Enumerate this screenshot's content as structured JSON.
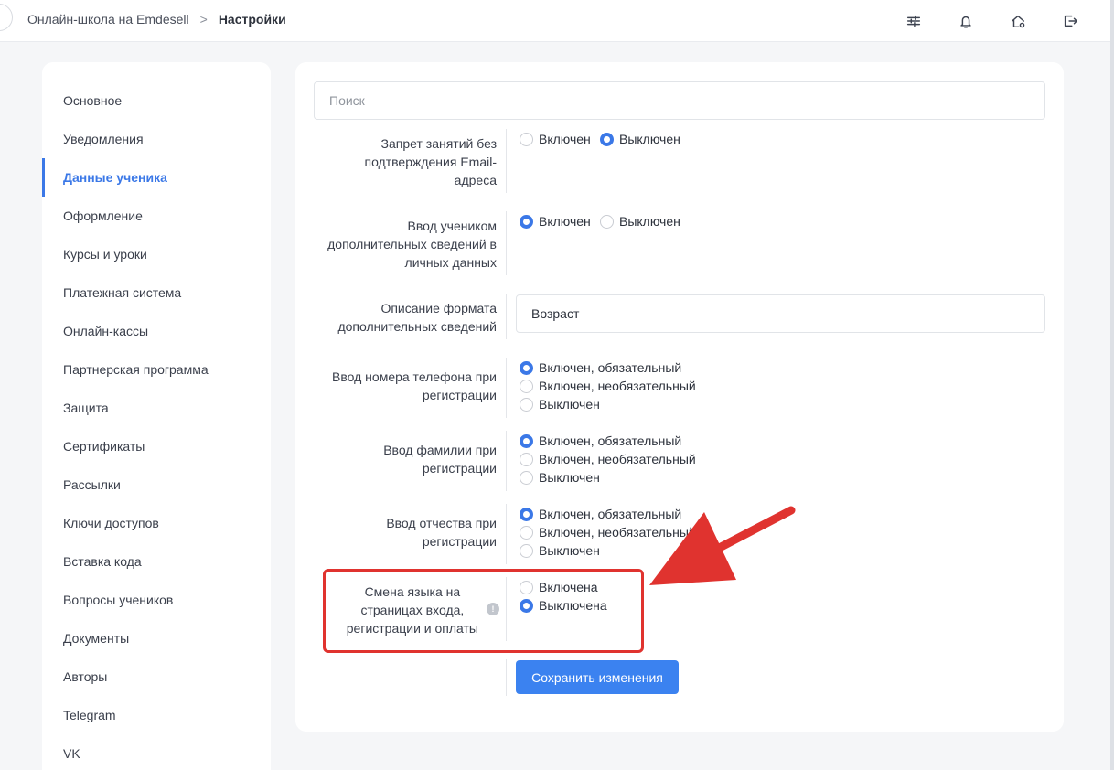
{
  "header": {
    "breadcrumb_root": "Онлайн-школа на Emdesell",
    "breadcrumb_separator": ">",
    "breadcrumb_current": "Настройки",
    "icons": [
      "sliders-icon",
      "bell-icon",
      "home-settings-icon",
      "logout-icon"
    ]
  },
  "sidebar": {
    "active_index": 2,
    "items": [
      {
        "label": "Основное"
      },
      {
        "label": "Уведомления"
      },
      {
        "label": "Данные ученика"
      },
      {
        "label": "Оформление"
      },
      {
        "label": "Курсы и уроки"
      },
      {
        "label": "Платежная система"
      },
      {
        "label": "Онлайн-кассы"
      },
      {
        "label": "Партнерская программа"
      },
      {
        "label": "Защита"
      },
      {
        "label": "Сертификаты"
      },
      {
        "label": "Рассылки"
      },
      {
        "label": "Ключи доступов"
      },
      {
        "label": "Вставка кода"
      },
      {
        "label": "Вопросы учеников"
      },
      {
        "label": "Документы"
      },
      {
        "label": "Авторы"
      },
      {
        "label": "Telegram"
      },
      {
        "label": "VK"
      }
    ]
  },
  "main": {
    "search_placeholder": "Поиск",
    "settings": {
      "email_confirm": {
        "label_lines": [
          "Запрет занятий без",
          "подтверждения Email-",
          "адреса"
        ],
        "options": [
          "Включен",
          "Выключен"
        ],
        "selected": 1
      },
      "extra_info": {
        "label_lines": [
          "Ввод учеником",
          "дополнительных сведений в",
          "личных данных"
        ],
        "options": [
          "Включен",
          "Выключен"
        ],
        "selected": 0
      },
      "extra_info_format": {
        "label_lines": [
          "Описание формата",
          "дополнительных сведений"
        ],
        "value": "Возраст"
      },
      "phone": {
        "label_lines": [
          "Ввод номера телефона при",
          "регистрации"
        ],
        "options": [
          "Включен, обязательный",
          "Включен, необязательный",
          "Выключен"
        ],
        "selected": 0
      },
      "last_name": {
        "label_lines": [
          "Ввод фамилии при",
          "регистрации"
        ],
        "options": [
          "Включен, обязательный",
          "Включен, необязательный",
          "Выключен"
        ],
        "selected": 0
      },
      "patronymic": {
        "label_lines": [
          "Ввод отчества при",
          "регистрации"
        ],
        "options": [
          "Включен, обязательный",
          "Включен, необязательный",
          "Выключен"
        ],
        "selected": 0
      },
      "language_switch": {
        "label_lines": [
          "Смена языка на",
          "страницах входа,",
          "регистрации и оплаты"
        ],
        "info_symbol": "!",
        "options": [
          "Включена",
          "Выключена"
        ],
        "selected": 1
      }
    },
    "save_label": "Сохранить изменения"
  },
  "annotation": {
    "highlight_color": "#e0332f"
  },
  "colors": {
    "accent": "#3b78e7",
    "button": "#3b82f0"
  }
}
